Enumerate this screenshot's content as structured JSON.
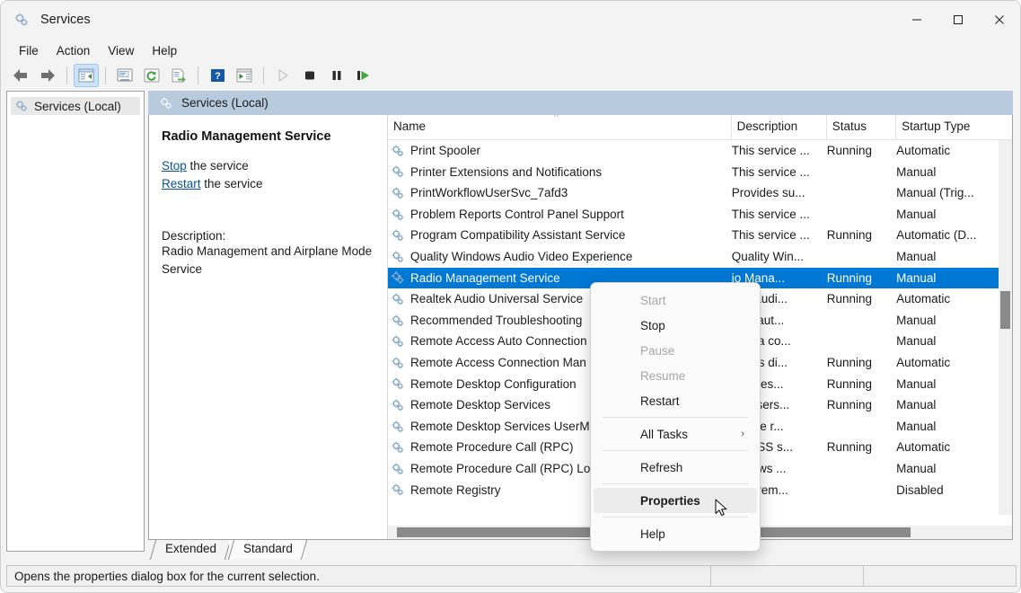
{
  "window": {
    "title": "Services",
    "icon": "services-gear-icon",
    "controls": {
      "minimize": "—",
      "maximize": "□",
      "close": "✕"
    }
  },
  "menubar": {
    "items": [
      "File",
      "Action",
      "View",
      "Help"
    ]
  },
  "toolbar": {
    "buttons": [
      {
        "name": "back-icon",
        "glyph": "back"
      },
      {
        "name": "forward-icon",
        "glyph": "forward"
      },
      {
        "name": "show-hide-console-tree-icon",
        "glyph": "tree"
      },
      {
        "name": "properties-icon",
        "glyph": "props"
      },
      {
        "name": "refresh-icon",
        "glyph": "refresh"
      },
      {
        "name": "export-list-icon",
        "glyph": "export"
      },
      {
        "name": "help-icon",
        "glyph": "help"
      },
      {
        "name": "show-hide-action-pane-icon",
        "glyph": "actionpane"
      },
      {
        "name": "start-service-icon",
        "glyph": "play"
      },
      {
        "name": "stop-service-icon",
        "glyph": "stop"
      },
      {
        "name": "pause-service-icon",
        "glyph": "pause"
      },
      {
        "name": "restart-service-icon",
        "glyph": "restart"
      }
    ]
  },
  "tree": {
    "root_label": "Services (Local)"
  },
  "tab": {
    "label": "Services (Local)"
  },
  "details": {
    "title": "Radio Management Service",
    "link_stop": "Stop",
    "link_stop_suffix": " the service",
    "link_restart": "Restart",
    "link_restart_suffix": " the service",
    "description_label": "Description:",
    "description_text": "Radio Management and Airplane Mode Service"
  },
  "list": {
    "columns": [
      "Name",
      "Description",
      "Status",
      "Startup Type"
    ],
    "sort_column": "Name",
    "sort_direction": "ascending",
    "rows": [
      {
        "name": "Print Spooler",
        "description": "This service ...",
        "status": "Running",
        "startup": "Automatic",
        "selected": false
      },
      {
        "name": "Printer Extensions and Notifications",
        "description": "This service ...",
        "status": "",
        "startup": "Manual",
        "selected": false
      },
      {
        "name": "PrintWorkflowUserSvc_7afd3",
        "description": "Provides su...",
        "status": "",
        "startup": "Manual (Trig...",
        "selected": false
      },
      {
        "name": "Problem Reports Control Panel Support",
        "description": "This service ...",
        "status": "",
        "startup": "Manual",
        "selected": false
      },
      {
        "name": "Program Compatibility Assistant Service",
        "description": "This service ...",
        "status": "Running",
        "startup": "Automatic (D...",
        "selected": false
      },
      {
        "name": "Quality Windows Audio Video Experience",
        "description": "Quality Win...",
        "status": "",
        "startup": "Manual",
        "selected": false
      },
      {
        "name": "Radio Management Service",
        "description": "io Mana...",
        "status": "Running",
        "startup": "Manual",
        "selected": true
      },
      {
        "name": "Realtek Audio Universal Service",
        "description": "ltek Audi...",
        "status": "Running",
        "startup": "Automatic",
        "selected": false
      },
      {
        "name": "Recommended Troubleshooting",
        "description": "bles aut...",
        "status": "",
        "startup": "Manual",
        "selected": false
      },
      {
        "name": "Remote Access Auto Connection",
        "description": "ates a co...",
        "status": "",
        "startup": "Manual",
        "selected": false
      },
      {
        "name": "Remote Access Connection Man",
        "description": "nages di...",
        "status": "Running",
        "startup": "Automatic",
        "selected": false
      },
      {
        "name": "Remote Desktop Configuration",
        "description": "ote Des...",
        "status": "Running",
        "startup": "Manual",
        "selected": false
      },
      {
        "name": "Remote Desktop Services",
        "description": "ws users...",
        "status": "Running",
        "startup": "Manual",
        "selected": false
      },
      {
        "name": "Remote Desktop Services UserM",
        "description": "ws the r...",
        "status": "",
        "startup": "Manual",
        "selected": false
      },
      {
        "name": "Remote Procedure Call (RPC)",
        "description": "RPCSS s...",
        "status": "Running",
        "startup": "Automatic",
        "selected": false
      },
      {
        "name": "Remote Procedure Call (RPC) Lo",
        "description": "/indows ...",
        "status": "",
        "startup": "Manual",
        "selected": false
      },
      {
        "name": "Remote Registry",
        "description": "bles rem...",
        "status": "",
        "startup": "Disabled",
        "selected": false
      }
    ]
  },
  "bottom_tabs": {
    "items": [
      "Extended",
      "Standard"
    ],
    "active": "Standard"
  },
  "statusbar": {
    "text": "Opens the properties dialog box for the current selection."
  },
  "context_menu": {
    "items": [
      {
        "label": "Start",
        "disabled": true,
        "highlighted": false,
        "submenu": false,
        "sep_after": false
      },
      {
        "label": "Stop",
        "disabled": false,
        "highlighted": false,
        "submenu": false,
        "sep_after": false
      },
      {
        "label": "Pause",
        "disabled": true,
        "highlighted": false,
        "submenu": false,
        "sep_after": false
      },
      {
        "label": "Resume",
        "disabled": true,
        "highlighted": false,
        "submenu": false,
        "sep_after": false
      },
      {
        "label": "Restart",
        "disabled": false,
        "highlighted": false,
        "submenu": false,
        "sep_after": true
      },
      {
        "label": "All Tasks",
        "disabled": false,
        "highlighted": false,
        "submenu": true,
        "sep_after": true
      },
      {
        "label": "Refresh",
        "disabled": false,
        "highlighted": false,
        "submenu": false,
        "sep_after": true
      },
      {
        "label": "Properties",
        "disabled": false,
        "highlighted": true,
        "submenu": false,
        "sep_after": true
      },
      {
        "label": "Help",
        "disabled": false,
        "highlighted": false,
        "submenu": false,
        "sep_after": false
      }
    ],
    "submenu_arrow": "›"
  },
  "colors": {
    "selection_blue": "#0078d4",
    "tab_header_blue": "#b8cade",
    "link_blue": "#0a51a1",
    "toolbar_active": "#cde3f7"
  }
}
